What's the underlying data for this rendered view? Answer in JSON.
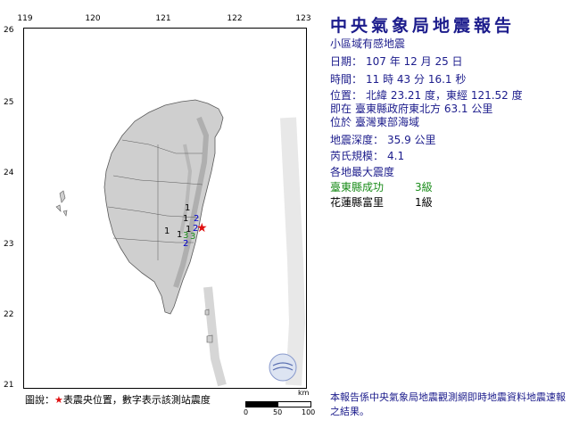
{
  "report": {
    "title": "中央氣象局地震報告",
    "subtitle": "小區域有感地震",
    "date_label": "日期：",
    "date_value": "107 年 12 月 25 日",
    "time_label": "時間：",
    "time_value": "11 時 43 分 16.1 秒",
    "pos_label": "位置：",
    "pos_value": "北緯 23.21 度，東經 121.52 度",
    "loc_line1_label": "即在",
    "loc_line1_value": "臺東縣政府東北方 63.1 公里",
    "loc_line2_label": "位於",
    "loc_line2_value": "臺灣東部海域",
    "depth_label": "地震深度：",
    "depth_value": "35.9 公里",
    "mag_label": "芮氏規模：",
    "mag_value": "4.1",
    "max_int_label": "各地最大震度"
  },
  "intensities": [
    {
      "station": "臺東縣成功",
      "level": "3級",
      "color": "#1a8c1a"
    },
    {
      "station": "花蓮縣富里",
      "level": "1級",
      "color": "#000000"
    }
  ],
  "axes": {
    "lon_ticks": [
      "119",
      "120",
      "121",
      "122",
      "123"
    ],
    "lat_ticks": [
      "26",
      "25",
      "24",
      "23",
      "22",
      "21"
    ]
  },
  "map": {
    "epicenter_marker": "★",
    "epicenter_color": "#e01010",
    "station_labels": [
      {
        "text": "1",
        "color": "#000000"
      },
      {
        "text": "2",
        "color": "#0000cc"
      },
      {
        "text": "1",
        "color": "#000000"
      },
      {
        "text": "1",
        "color": "#000000"
      },
      {
        "text": "1",
        "color": "#000000"
      },
      {
        "text": "1",
        "color": "#000000"
      },
      {
        "text": "2",
        "color": "#0000cc"
      },
      {
        "text": "3",
        "color": "#1a8c1a"
      },
      {
        "text": "3",
        "color": "#1a8c1a"
      },
      {
        "text": "2",
        "color": "#0000cc"
      }
    ]
  },
  "legend": {
    "prefix": "圖說：",
    "star": "★",
    "text": "表震央位置，數字表示該測站震度"
  },
  "scale": {
    "unit": "km",
    "labels": [
      "0",
      "50",
      "100"
    ]
  },
  "note": "本報告係中央氣象局地震觀測網即時地震資料地震速報之結果。",
  "colors": {
    "text_primary": "#1c1c8c",
    "map_land": "#c9c9c9",
    "sea": "#ffffff"
  }
}
